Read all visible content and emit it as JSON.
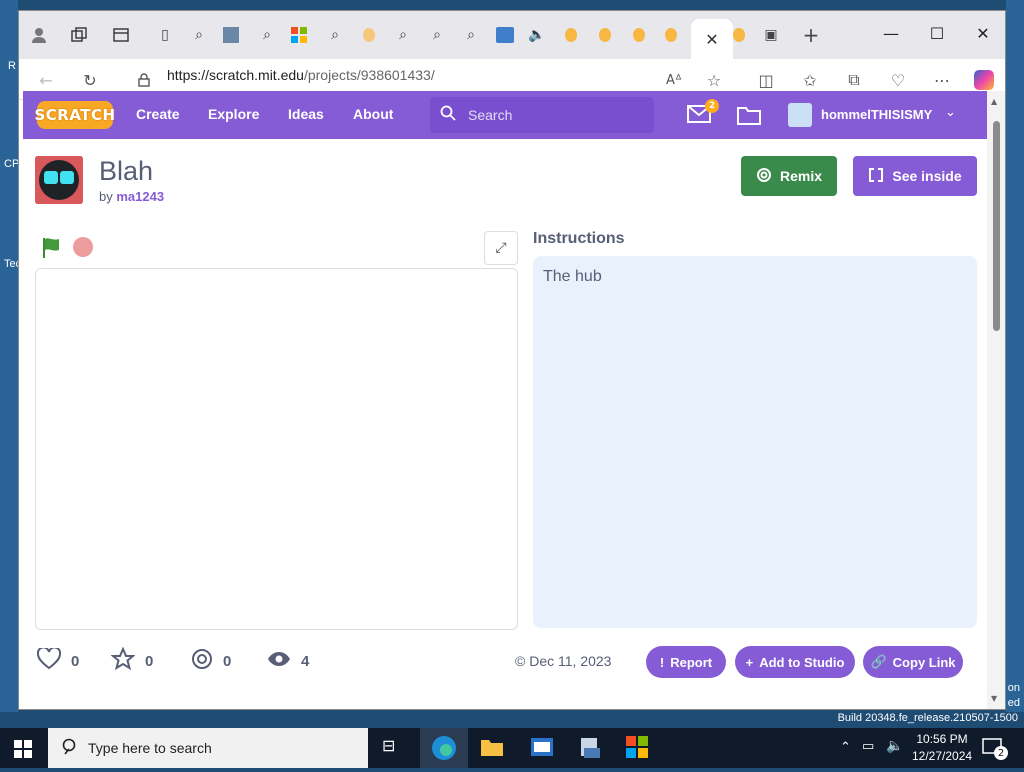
{
  "desktop": {
    "left_labels": [
      "R",
      "CP",
      "Tec"
    ],
    "right_labels": [
      "on",
      "ed"
    ],
    "build": "Build 20348.fe_release.210507-1500"
  },
  "browser": {
    "url_host": "https://scratch.mit.edu",
    "url_path": "/projects/938601433/",
    "tab_close": "✕"
  },
  "nav": {
    "logo": "SCRATCH",
    "links": [
      "Create",
      "Explore",
      "Ideas",
      "About"
    ],
    "search_placeholder": "Search",
    "message_count": "2",
    "username": "hommelTHISISMY"
  },
  "project": {
    "title": "Blah",
    "by": "by",
    "author": "ma1243",
    "remix_label": "Remix",
    "see_inside_label": "See inside",
    "instructions_heading": "Instructions",
    "instructions_text": "The hub",
    "stats": {
      "loves": "0",
      "favorites": "0",
      "remixes": "0",
      "views": "4"
    },
    "date": "Dec 11, 2023",
    "report_label": "Report",
    "add_to_studio_label": "Add to Studio",
    "copy_link_label": "Copy Link"
  },
  "taskbar": {
    "search_placeholder": "Type here to search",
    "time": "10:56 PM",
    "date": "12/27/2024",
    "notification_count": "2"
  },
  "colors": {
    "scratch_purple": "#855cd6",
    "remix_green": "#3a8a4c",
    "instructions_bg": "#e9f1fc"
  }
}
